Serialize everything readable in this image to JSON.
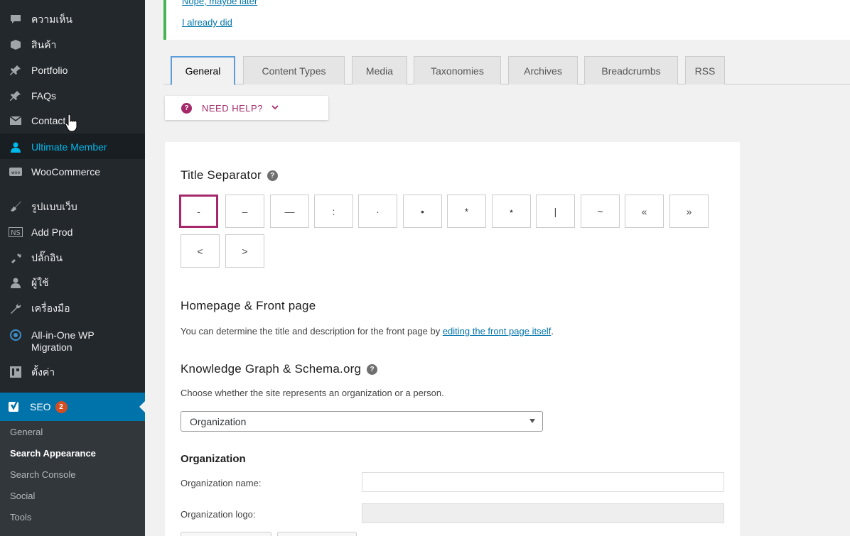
{
  "sidebar": {
    "items": [
      {
        "label": "ความเห็น",
        "icon": "comment-icon"
      },
      {
        "label": "สินค้า",
        "icon": "box-icon"
      },
      {
        "label": "Portfolio",
        "icon": "pin-icon"
      },
      {
        "label": "FAQs",
        "icon": "pin-icon"
      },
      {
        "label": "Contact",
        "icon": "mail-icon"
      },
      {
        "label": "Ultimate Member",
        "icon": "user-icon"
      },
      {
        "label": "WooCommerce",
        "icon": "woo-icon"
      },
      {
        "label": "รูปแบบเว็บ",
        "icon": "brush-icon"
      },
      {
        "label": "Add Prod",
        "icon": "ns-icon"
      },
      {
        "label": "ปลั๊กอิน",
        "icon": "plug-icon"
      },
      {
        "label": "ผู้ใช้",
        "icon": "user-icon"
      },
      {
        "label": "เครื่องมือ",
        "icon": "wrench-icon"
      },
      {
        "label": "All-in-One WP Migration",
        "icon": "migration-icon"
      },
      {
        "label": "ตั้งค่า",
        "icon": "settings-icon"
      }
    ],
    "seo": {
      "label": "SEO",
      "badge": "2"
    },
    "submenu": [
      "General",
      "Search Appearance",
      "Search Console",
      "Social",
      "Tools"
    ]
  },
  "notice": {
    "link_top": "Nope, maybe later",
    "link_bottom": "I already did"
  },
  "tabs": [
    "General",
    "Content Types",
    "Media",
    "Taxonomies",
    "Archives",
    "Breadcrumbs",
    "RSS"
  ],
  "help": {
    "label": "NEED HELP?",
    "icon": "question-icon"
  },
  "title_separator": {
    "heading": "Title Separator",
    "options": [
      "-",
      "–",
      "—",
      ":",
      "·",
      "•",
      "*",
      "⋆",
      "|",
      "~",
      "«",
      "»",
      "<",
      ">"
    ],
    "selected_index": 0
  },
  "homepage": {
    "heading": "Homepage & Front page",
    "text": "You can determine the title and description for the front page by ",
    "link": "editing the front page itself",
    "text_end": "."
  },
  "knowledge_graph": {
    "heading": "Knowledge Graph & Schema.org",
    "text": "Choose whether the site represents an organization or a person.",
    "selected": "Organization"
  },
  "organization": {
    "heading": "Organization",
    "name_label": "Organization name:",
    "name_value": "",
    "logo_label": "Organization logo:"
  },
  "colors": {
    "accent": "#a4286a",
    "wp_blue": "#0073aa",
    "sidebar": "#23282d"
  }
}
